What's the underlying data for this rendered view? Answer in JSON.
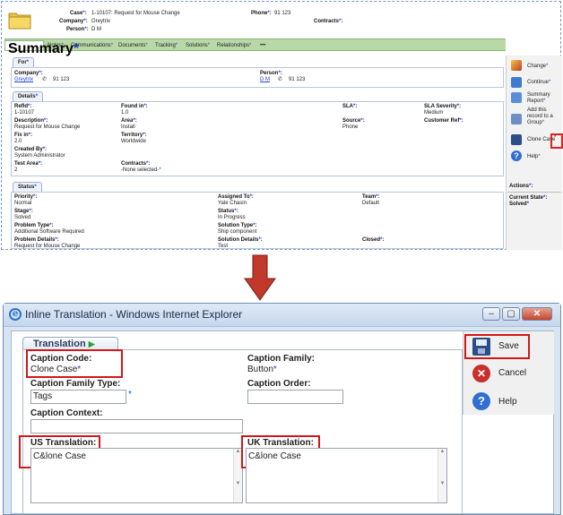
{
  "crm": {
    "header": {
      "case_label": "Case",
      "case_value": "1-10107: Request for Mouse Change",
      "company_label": "Company",
      "company_value": "Greytrix",
      "person_label": "Person",
      "person_value": "D M",
      "phone_label": "Phone",
      "phone_value": "91 123",
      "contracts_label": "Contracts"
    },
    "tabs": [
      "Summary",
      "Notes",
      "Communications",
      "Documents",
      "Tracking",
      "Solutions",
      "Relationships",
      "•••"
    ],
    "for": {
      "title": "For",
      "company_label": "Company",
      "company_value": "Greytrix",
      "company_phone": "91 123",
      "person_label": "Person",
      "person_value": "D M",
      "person_phone": "91 123"
    },
    "details": {
      "title": "Details",
      "refid_label": "RefId",
      "refid_value": "1-10107",
      "foundin_label": "Found in",
      "foundin_value": "1.0",
      "sla_label": "SLA",
      "slasev_label": "SLA Severity",
      "slasev_value": "Medium",
      "desc_label": "Description",
      "desc_value": "Request for Mouse Change",
      "area_label": "Area",
      "area_value": "Install",
      "source_label": "Source",
      "source_value": "Phone",
      "custref_label": "Customer Ref",
      "fixin_label": "Fix in",
      "fixin_value": "2.0",
      "territory_label": "Territory",
      "territory_value": "Worldwide",
      "createdby_label": "Created By",
      "createdby_value": "System Administrator",
      "testarea_label": "Test Area",
      "testarea_value": "2",
      "contracts_label": "Contracts",
      "contracts_value": "-None selected-"
    },
    "status": {
      "title": "Status",
      "priority_label": "Priority",
      "priority_value": "Normal",
      "assigned_label": "Assigned To",
      "assigned_value": "Yale Chasin",
      "team_label": "Team",
      "team_value": "Default",
      "stage_label": "Stage",
      "stage_value": "Solved",
      "status_label": "Status",
      "status_value": "In Progress",
      "ptype_label": "Problem Type",
      "ptype_value": "Additional Software Required",
      "stype_label": "Solution Type",
      "stype_value": "Ship component",
      "pdetails_label": "Problem Details",
      "pdetails_value": "Request for Mouse Change",
      "sdetails_label": "Solution Details",
      "sdetails_value": "Test",
      "closed_label": "Closed"
    },
    "actions": {
      "change": "Change",
      "continue": "Continue",
      "summary_report": "Summary Report",
      "add_group": "Add this record to a Group",
      "clone_case": "Clone Case",
      "help": "Help"
    },
    "workflow": {
      "actions_label": "Actions",
      "current_state_label": "Current State",
      "current_state_value": "Solved"
    }
  },
  "dialog": {
    "title": "Inline Translation - Windows Internet Explorer",
    "tab": "Translation",
    "caption_code_label": "Caption Code:",
    "caption_code_value": "Clone Case",
    "caption_family_label": "Caption Family:",
    "caption_family_value": "Button",
    "caption_family_type_label": "Caption Family Type:",
    "caption_family_type_value": "Tags",
    "caption_order_label": "Caption Order:",
    "caption_order_value": "",
    "caption_context_label": "Caption Context:",
    "caption_context_value": "",
    "us_label": "US Translation:",
    "us_value": "C&lone Case",
    "uk_label": "UK Translation:",
    "uk_value": "C&lone Case",
    "save": "Save",
    "cancel": "Cancel",
    "help": "Help"
  },
  "colors": {
    "highlight": "#d01818",
    "arrow": "#c0392b",
    "tab_bar": "#b9d8a7",
    "link": "#1f3ee8"
  }
}
